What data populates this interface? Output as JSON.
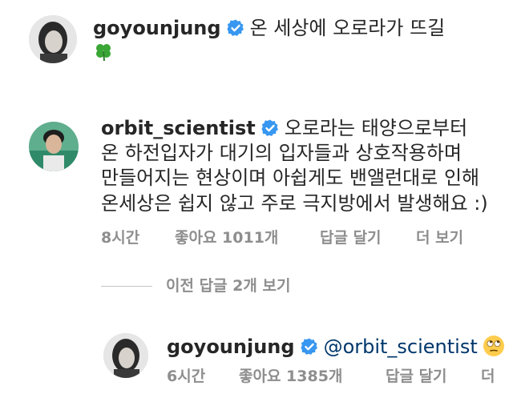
{
  "comment1": {
    "username": "goyounjung",
    "text": "온 세상에 오로라가 뜨길",
    "emoji_icon": "four-leaf-clover-icon"
  },
  "comment2": {
    "username": "orbit_scientist",
    "text_line1": "오로라는 태양으로부터",
    "text_line2": "온 하전입자가 대기의 입자들과 상호작용하며",
    "text_line3": "만들어지는 현상이며 아쉽게도 밴앨런대로 인해",
    "text_line4": "온세상은 쉽지 않고 주로 극지방에서 발생해요 :)",
    "time": "8시간",
    "likes": "좋아요 1011개",
    "reply": "답글 달기",
    "more": "더 보기"
  },
  "view_replies": "이전 답글 2개 보기",
  "reply1": {
    "username": "goyounjung",
    "mention": "@orbit_scientist",
    "emoji_icon": "face-with-rolling-eyes-icon",
    "time": "6시간",
    "likes": "좋아요 1385개",
    "reply": "답글 달기",
    "more": "더"
  },
  "colors": {
    "verified": "#3897f0",
    "meta_text": "#8e8e8e",
    "mention": "#00376b"
  }
}
